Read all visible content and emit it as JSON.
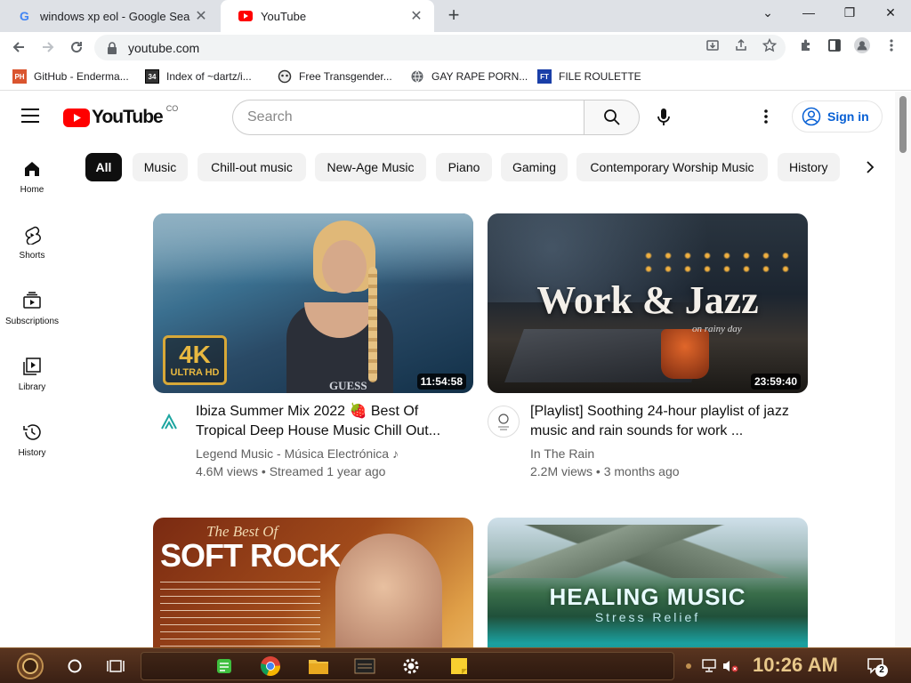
{
  "browser": {
    "tabs": [
      {
        "title": "windows xp eol - Google Search",
        "favicon": "google-g-icon"
      },
      {
        "title": "YouTube",
        "favicon": "youtube-icon"
      }
    ],
    "url": "youtube.com",
    "bookmarks": [
      {
        "label": "GitHub - Enderma...",
        "icon": "ph-icon"
      },
      {
        "label": "Index of ~dartz/i...",
        "icon": "folder-icon"
      },
      {
        "label": "Free Transgender...",
        "icon": "mask-icon"
      },
      {
        "label": "GAY RAPE PORN...",
        "icon": "globe-icon"
      },
      {
        "label": "FILE ROULETTE",
        "icon": "ft-icon"
      }
    ]
  },
  "youtube": {
    "logo_text": "YouTube",
    "region": "CO",
    "search_placeholder": "Search",
    "signin_label": "Sign in",
    "chips": [
      "All",
      "Music",
      "Chill-out music",
      "New-Age Music",
      "Piano",
      "Gaming",
      "Contemporary Worship Music",
      "History"
    ],
    "guide": [
      {
        "label": "Home",
        "icon": "home-icon"
      },
      {
        "label": "Shorts",
        "icon": "shorts-icon"
      },
      {
        "label": "Subscriptions",
        "icon": "subscriptions-icon"
      },
      {
        "label": "Library",
        "icon": "library-icon"
      },
      {
        "label": "History",
        "icon": "history-icon"
      }
    ],
    "videos": [
      {
        "title": "Ibiza Summer Mix 2022 🍓 Best Of Tropical Deep House Music Chill Out...",
        "channel": "Legend Music - Música Electrónica ♪",
        "meta": "4.6M views • Streamed 1 year ago",
        "duration": "11:54:58",
        "badge_top": "4K",
        "badge_bottom": "ULTRA HD",
        "thumb_text": "GUESS"
      },
      {
        "title": "[Playlist] Soothing 24-hour playlist of jazz music and rain sounds for work ...",
        "channel": "In The Rain",
        "meta": "2.2M views • 3 months ago",
        "duration": "23:59:40",
        "thumb_title": "Work & Jazz",
        "thumb_sub": "on rainy day"
      },
      {
        "thumb_title_small": "The Best Of",
        "thumb_title": "SOFT ROCK"
      },
      {
        "thumb_title": "HEALING MUSIC",
        "thumb_sub": "Stress Relief"
      }
    ]
  },
  "taskbar": {
    "time": "10:26 AM",
    "notification_count": "2"
  },
  "colors": {
    "youtube_red": "#ff0000",
    "link_blue": "#065fd4",
    "chip_bg": "#f2f2f2"
  }
}
